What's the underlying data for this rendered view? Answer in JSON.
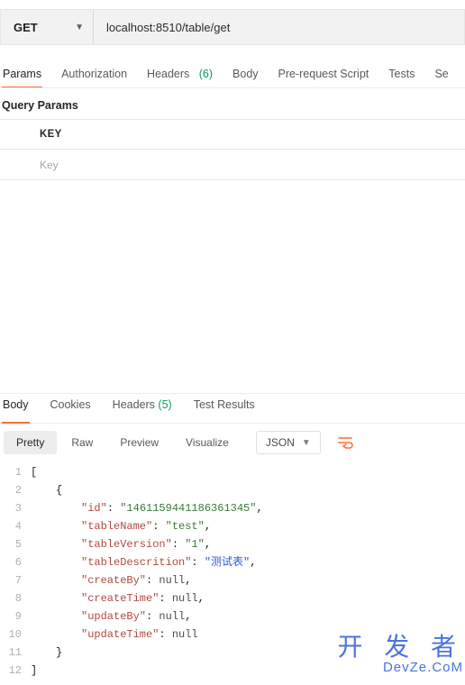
{
  "request": {
    "method": "GET",
    "url": "localhost:8510/table/get",
    "tabs": {
      "params": "Params",
      "auth": "Authorization",
      "headers_label": "Headers",
      "headers_count": "(6)",
      "body": "Body",
      "prerequest": "Pre-request Script",
      "tests": "Tests",
      "settings": "Se"
    },
    "query_params_title": "Query Params",
    "key_header": "KEY",
    "key_placeholder": "Key"
  },
  "response": {
    "tabs": {
      "body": "Body",
      "cookies": "Cookies",
      "headers_label": "Headers",
      "headers_count": "(5)",
      "tests": "Test Results"
    },
    "views": {
      "pretty": "Pretty",
      "raw": "Raw",
      "preview": "Preview",
      "visualize": "Visualize"
    },
    "format": "JSON"
  },
  "json_body": {
    "fields": [
      {
        "k": "id",
        "v": "1461159441186361345",
        "t": "str"
      },
      {
        "k": "tableName",
        "v": "test",
        "t": "str"
      },
      {
        "k": "tableVersion",
        "v": "1",
        "t": "str"
      },
      {
        "k": "tableDescrition",
        "v": "测试表",
        "t": "strb"
      },
      {
        "k": "createBy",
        "v": "null",
        "t": "null"
      },
      {
        "k": "createTime",
        "v": "null",
        "t": "null"
      },
      {
        "k": "updateBy",
        "v": "null",
        "t": "null"
      },
      {
        "k": "updateTime",
        "v": "null",
        "t": "null"
      }
    ]
  },
  "watermark": {
    "big": "开 发 者",
    "small": "DevZe.CoM"
  },
  "colors": {
    "accent": "#ff6c37",
    "green": "#0a9e5c"
  }
}
